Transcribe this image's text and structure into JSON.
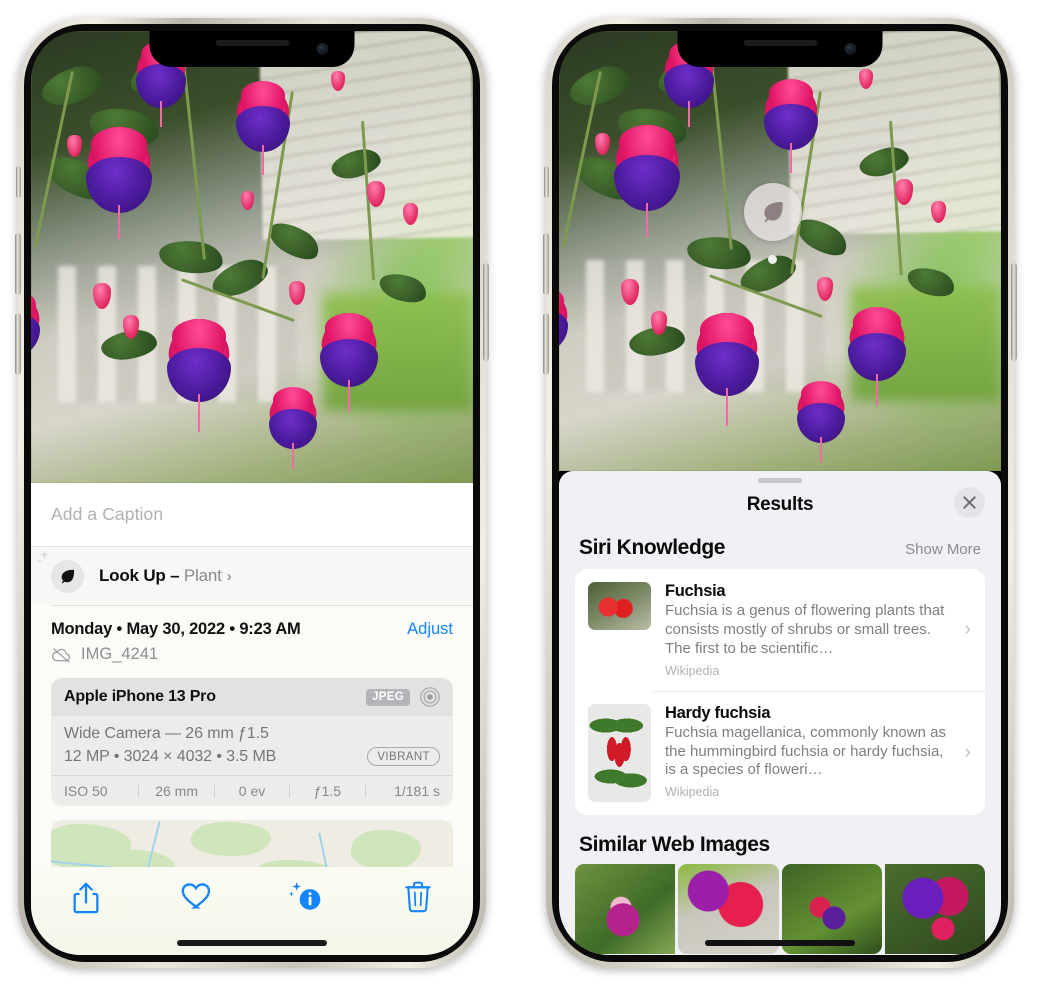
{
  "left_phone": {
    "caption_field": {
      "placeholder": "Add a Caption",
      "value": ""
    },
    "lookup_row": {
      "icon": "leaf-icon",
      "label_bold": "Look Up –",
      "label_plain": "Plant",
      "chevron": "›"
    },
    "metadata": {
      "date_line": "Monday • May 30, 2022 • 9:23 AM",
      "adjust_label": "Adjust",
      "cloud_icon": "cloud-slash-icon",
      "filename": "IMG_4241"
    },
    "exif": {
      "model": "Apple iPhone 13 Pro",
      "format_badge": "JPEG",
      "aperture_icon": "aperture-icon",
      "lens": "Wide Camera — 26 mm ƒ1.5",
      "size_line": "12 MP • 3024 × 4032 • 3.5 MB",
      "style_badge": "VIBRANT",
      "settings": [
        "ISO 50",
        "26 mm",
        "0 ev",
        "ƒ1.5",
        "1/181 s"
      ]
    },
    "toolbar": [
      {
        "name": "share-icon",
        "label": "Share"
      },
      {
        "name": "heart-icon",
        "label": "Favorite"
      },
      {
        "name": "info-sparkle-icon",
        "label": "Info"
      },
      {
        "name": "trash-icon",
        "label": "Delete"
      }
    ]
  },
  "right_phone": {
    "photo_badge": {
      "icon": "leaf-icon",
      "label": "Visual Look Up"
    },
    "sheet": {
      "title": "Results",
      "close_icon": "close-icon"
    },
    "siri_knowledge": {
      "title": "Siri Knowledge",
      "action": "Show More",
      "items": [
        {
          "title": "Fuchsia",
          "description": "Fuchsia is a genus of flowering plants that consists mostly of shrubs or small trees. The first to be scientific…",
          "source": "Wikipedia",
          "thumb": "fuchsia-red-thumb"
        },
        {
          "title": "Hardy fuchsia",
          "description": "Fuchsia magellanica, commonly known as the hummingbird fuchsia or hardy fuchsia, is a species of floweri…",
          "source": "Wikipedia",
          "thumb": "hardy-fuchsia-thumb"
        }
      ]
    },
    "similar_web_images": {
      "title": "Similar Web Images",
      "thumbnails": [
        "fuchsia-web-thumb-1",
        "fuchsia-web-thumb-2",
        "fuchsia-web-thumb-3",
        "fuchsia-web-thumb-4"
      ]
    }
  },
  "colors": {
    "accent_blue": "#1485fd",
    "sheet_bg": "#f1f0f5",
    "card_bg": "#ffffff",
    "secondary_text": "#8a8a90",
    "frame_silver": "#e7e4db"
  }
}
